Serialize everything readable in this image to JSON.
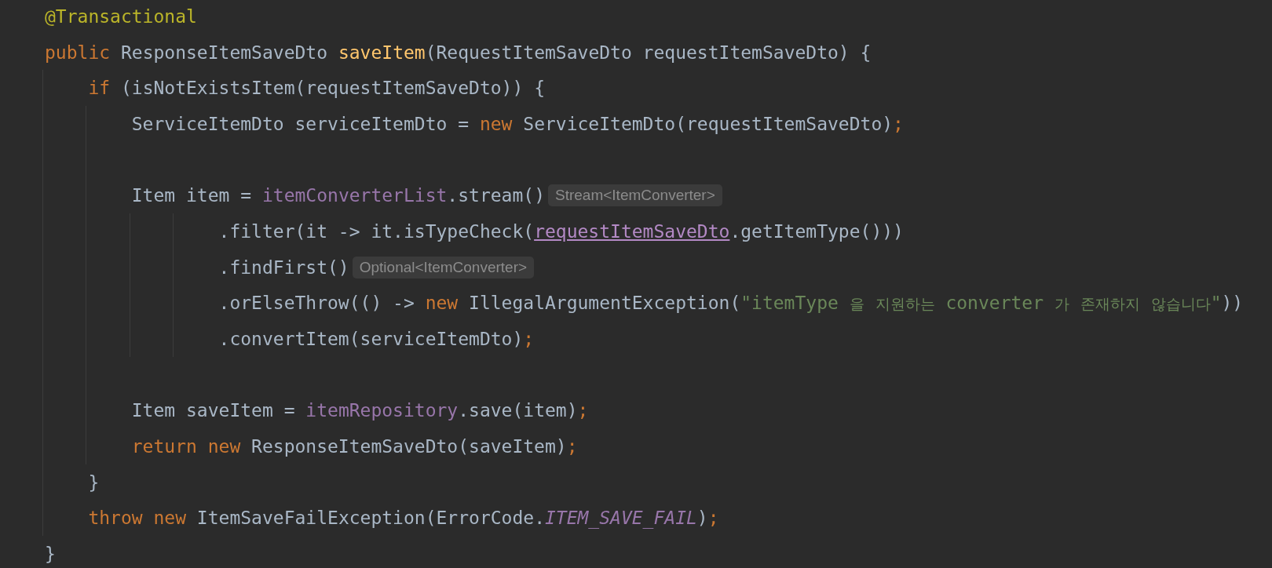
{
  "editor": {
    "lines": [
      {
        "kind": "code",
        "tokens": [
          {
            "text": "@Transactional",
            "kind": "annotation"
          }
        ]
      },
      {
        "kind": "code",
        "tokens": [
          {
            "text": "public",
            "kind": "keyword"
          },
          {
            "text": " ResponseItemSaveDto ",
            "kind": "plain"
          },
          {
            "text": "saveItem",
            "kind": "method_decl"
          },
          {
            "text": "(RequestItemSaveDto requestItemSaveDto) {",
            "kind": "plain"
          }
        ]
      },
      {
        "kind": "code",
        "tokens": [
          {
            "text": "    if",
            "kind": "keyword"
          },
          {
            "text": " (isNotExistsItem(requestItemSaveDto)) {",
            "kind": "plain"
          }
        ]
      },
      {
        "kind": "code",
        "tokens": [
          {
            "text": "        ServiceItemDto serviceItemDto = ",
            "kind": "plain"
          },
          {
            "text": "new",
            "kind": "keyword"
          },
          {
            "text": " ServiceItemDto(requestItemSaveDto)",
            "kind": "plain"
          },
          {
            "text": ";",
            "kind": "keyword"
          }
        ]
      },
      {
        "kind": "blank"
      },
      {
        "kind": "code",
        "tokens": [
          {
            "text": "        Item item = ",
            "kind": "plain"
          },
          {
            "text": "itemConverterList",
            "kind": "field"
          },
          {
            "text": ".stream()",
            "kind": "plain"
          },
          {
            "text": "Stream<ItemConverter>",
            "kind": "hint"
          }
        ]
      },
      {
        "kind": "code",
        "tokens": [
          {
            "text": "                .filter(it -> it.isTypeCheck(",
            "kind": "plain"
          },
          {
            "text": "requestItemSaveDto",
            "kind": "captured"
          },
          {
            "text": ".getItemType()))",
            "kind": "plain"
          }
        ]
      },
      {
        "kind": "code",
        "tokens": [
          {
            "text": "                .findFirst()",
            "kind": "plain"
          },
          {
            "text": "Optional<ItemConverter>",
            "kind": "hint"
          }
        ]
      },
      {
        "kind": "code",
        "tokens": [
          {
            "text": "                .orElseThrow(() -> ",
            "kind": "plain"
          },
          {
            "text": "new",
            "kind": "keyword"
          },
          {
            "text": " IllegalArgumentException(",
            "kind": "plain"
          },
          {
            "text": "\"itemType 을 지원하는 converter 가 존재하지 않습니다\"",
            "kind": "string"
          },
          {
            "text": "))",
            "kind": "plain"
          }
        ]
      },
      {
        "kind": "code",
        "tokens": [
          {
            "text": "                .convertItem(serviceItemDto)",
            "kind": "plain"
          },
          {
            "text": ";",
            "kind": "keyword"
          }
        ]
      },
      {
        "kind": "blank"
      },
      {
        "kind": "code",
        "tokens": [
          {
            "text": "        Item saveItem = ",
            "kind": "plain"
          },
          {
            "text": "itemRepository",
            "kind": "field"
          },
          {
            "text": ".save(item)",
            "kind": "plain"
          },
          {
            "text": ";",
            "kind": "keyword"
          }
        ]
      },
      {
        "kind": "code",
        "tokens": [
          {
            "text": "        return new",
            "kind": "keyword"
          },
          {
            "text": " ResponseItemSaveDto(saveItem)",
            "kind": "plain"
          },
          {
            "text": ";",
            "kind": "keyword"
          }
        ]
      },
      {
        "kind": "code",
        "tokens": [
          {
            "text": "    }",
            "kind": "plain"
          }
        ]
      },
      {
        "kind": "code",
        "tokens": [
          {
            "text": "    throw new",
            "kind": "keyword"
          },
          {
            "text": " ItemSaveFailException(ErrorCode.",
            "kind": "plain"
          },
          {
            "text": "ITEM_SAVE_FAIL",
            "kind": "static_field"
          },
          {
            "text": ")",
            "kind": "plain"
          },
          {
            "text": ";",
            "kind": "keyword"
          }
        ]
      },
      {
        "kind": "code",
        "tokens": [
          {
            "text": "}",
            "kind": "plain"
          }
        ]
      }
    ]
  }
}
